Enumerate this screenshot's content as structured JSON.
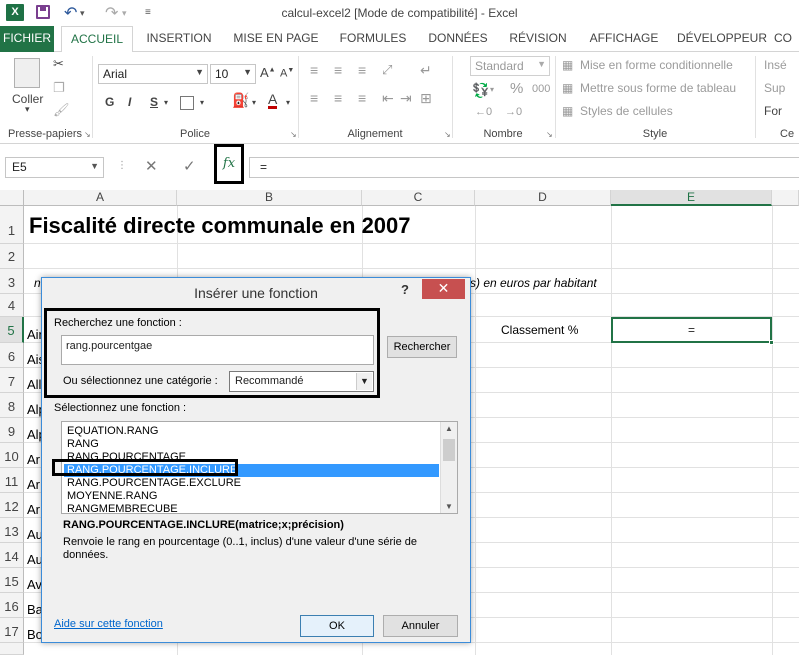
{
  "title_bar": {
    "app_icon": "X",
    "icons": [
      "excel-logo",
      "save-icon",
      "undo-icon",
      "redo-icon",
      "customize-icon"
    ],
    "title": "calcul-excel2  [Mode de compatibilité] - Excel"
  },
  "tabs": [
    {
      "label": "FICHIER"
    },
    {
      "label": "ACCUEIL"
    },
    {
      "label": "INSERTION"
    },
    {
      "label": "MISE EN PAGE"
    },
    {
      "label": "FORMULES"
    },
    {
      "label": "DONNÉES"
    },
    {
      "label": "RÉVISION"
    },
    {
      "label": "AFFICHAGE"
    },
    {
      "label": "DÉVELOPPEUR"
    },
    {
      "label": "CO"
    }
  ],
  "ribbon": {
    "clipboard": {
      "paste_label": "Coller",
      "group_label": "Presse-papiers"
    },
    "font": {
      "family": "Arial",
      "size": "10",
      "bold": "G",
      "italic": "I",
      "underline": "S",
      "group_label": "Police",
      "font_color": "#c00000"
    },
    "alignment": {
      "group_label": "Alignement"
    },
    "number": {
      "format": "Standard",
      "percent": "%",
      "thousands": "000",
      "group_label": "Nombre"
    },
    "style": {
      "cond_format": "Mise en forme conditionnelle",
      "table_format": "Mettre sous forme de tableau",
      "cell_styles": "Styles de cellules",
      "group_label": "Style"
    },
    "cells": {
      "insert": "Insé",
      "delete": "Sup",
      "format": "For",
      "group_label": "Ce"
    }
  },
  "formula_bar": {
    "name_box": "E5",
    "fx": "fx",
    "formula": "="
  },
  "columns": [
    "A",
    "B",
    "C",
    "D",
    "E"
  ],
  "rows": [
    "1",
    "2",
    "3",
    "4",
    "5",
    "6",
    "7",
    "8",
    "9",
    "10",
    "11",
    "12",
    "13",
    "14",
    "15",
    "16",
    "17"
  ],
  "cells": {
    "a1": "Fiscalité directe communale en 2007",
    "a3_partial": "n",
    "c3_partial": "s) en euros par habitant",
    "d5": "Classement %",
    "e5": "=",
    "a5": "Ain",
    "a6": "Ais",
    "a7": "All",
    "a8": "Alp",
    "a9": "Alp",
    "a10": "Ar",
    "a11": "Ar",
    "a12": "Ar",
    "a13": "Au",
    "a14": "Au",
    "a15": "Av",
    "a16": "Ba",
    "a17": "Bo"
  },
  "dialog": {
    "title": "Insérer une fonction",
    "help": "?",
    "close": "✕",
    "search_label": "Recherchez une fonction :",
    "search_value": "rang.pourcentgae",
    "search_button": "Rechercher",
    "category_label": "Ou sélectionnez une catégorie :",
    "category_value": "Recommandé",
    "select_label": "Sélectionnez une fonction :",
    "functions": [
      "EQUATION.RANG",
      "RANG",
      "RANG.POURCENTAGE",
      "RANG.POURCENTAGE.INCLURE",
      "RANG.POURCENTAGE.EXCLURE",
      "MOYENNE.RANG",
      "RANGMEMBRECUBE"
    ],
    "selected_index": 3,
    "signature": "RANG.POURCENTAGE.INCLURE(matrice;x;précision)",
    "description": "Renvoie le rang en pourcentage (0..1, inclus) d'une valeur d'une série de données.",
    "help_link": "Aide sur cette fonction",
    "ok": "OK",
    "cancel": "Annuler"
  },
  "colors": {
    "excel_green": "#217346",
    "selection_blue": "#3399ff",
    "close_red": "#c75050",
    "highlight_black": "#000000"
  }
}
